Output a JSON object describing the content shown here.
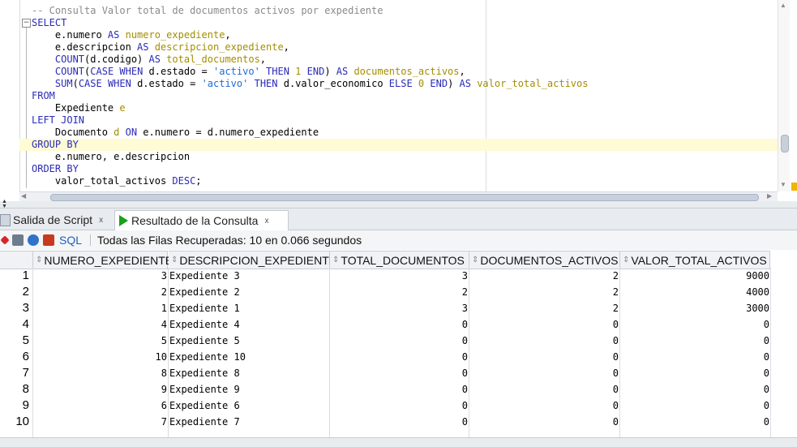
{
  "editor": {
    "lines": [
      [
        {
          "t": "-- Consulta Valor total de documentos activos por expediente",
          "c": "cm"
        }
      ],
      [
        {
          "t": "SELECT",
          "c": "kw"
        }
      ],
      [
        {
          "t": "    e.numero "
        },
        {
          "t": "AS",
          "c": "kw"
        },
        {
          "t": " numero_expediente",
          "c": "al"
        },
        {
          "t": ","
        }
      ],
      [
        {
          "t": "    e.descripcion "
        },
        {
          "t": "AS",
          "c": "kw"
        },
        {
          "t": " descripcion_expediente",
          "c": "al"
        },
        {
          "t": ","
        }
      ],
      [
        {
          "t": "    "
        },
        {
          "t": "COUNT",
          "c": "kw"
        },
        {
          "t": "(d.codigo) "
        },
        {
          "t": "AS",
          "c": "kw"
        },
        {
          "t": " total_documentos",
          "c": "al"
        },
        {
          "t": ","
        }
      ],
      [
        {
          "t": "    "
        },
        {
          "t": "COUNT",
          "c": "kw"
        },
        {
          "t": "("
        },
        {
          "t": "CASE WHEN",
          "c": "kw"
        },
        {
          "t": " d.estado = "
        },
        {
          "t": "'activo'",
          "c": "str"
        },
        {
          "t": " "
        },
        {
          "t": "THEN",
          "c": "kw"
        },
        {
          "t": " 1 ",
          "c": "al"
        },
        {
          "t": "END",
          "c": "kw"
        },
        {
          "t": ") "
        },
        {
          "t": "AS",
          "c": "kw"
        },
        {
          "t": " documentos_activos",
          "c": "al"
        },
        {
          "t": ","
        }
      ],
      [
        {
          "t": "    "
        },
        {
          "t": "SUM",
          "c": "kw"
        },
        {
          "t": "("
        },
        {
          "t": "CASE WHEN",
          "c": "kw"
        },
        {
          "t": " d.estado = "
        },
        {
          "t": "'activo'",
          "c": "str"
        },
        {
          "t": " "
        },
        {
          "t": "THEN",
          "c": "kw"
        },
        {
          "t": " d.valor_economico "
        },
        {
          "t": "ELSE",
          "c": "kw"
        },
        {
          "t": " 0 ",
          "c": "al"
        },
        {
          "t": "END",
          "c": "kw"
        },
        {
          "t": ") "
        },
        {
          "t": "AS",
          "c": "kw"
        },
        {
          "t": " valor_total_activos",
          "c": "al"
        }
      ],
      [
        {
          "t": "FROM",
          "c": "kw"
        }
      ],
      [
        {
          "t": "    Expediente "
        },
        {
          "t": "e",
          "c": "al"
        }
      ],
      [
        {
          "t": "LEFT JOIN",
          "c": "kw"
        }
      ],
      [
        {
          "t": "    Documento "
        },
        {
          "t": "d",
          "c": "al"
        },
        {
          "t": " "
        },
        {
          "t": "ON",
          "c": "kw"
        },
        {
          "t": " e.numero = d.numero_expediente"
        }
      ],
      [
        {
          "t": "GROUP BY",
          "c": "kw"
        }
      ],
      [
        {
          "t": "    e.numero, e.descripcion"
        }
      ],
      [
        {
          "t": "ORDER BY",
          "c": "kw"
        }
      ],
      [
        {
          "t": "    valor_total_activos "
        },
        {
          "t": "DESC",
          "c": "kw"
        },
        {
          "t": ";"
        }
      ]
    ],
    "current_line_index": 11
  },
  "tabs": [
    {
      "label": "Salida de Script",
      "close": "x",
      "active": false
    },
    {
      "label": "Resultado de la Consulta",
      "close": "x",
      "active": true
    }
  ],
  "toolbar": {
    "sql_label": "SQL",
    "status": "Todas las Filas Recuperadas: 10 en 0.066 segundos"
  },
  "grid": {
    "columns": [
      "NUMERO_EXPEDIENTE",
      "DESCRIPCION_EXPEDIENTE",
      "TOTAL_DOCUMENTOS",
      "DOCUMENTOS_ACTIVOS",
      "VALOR_TOTAL_ACTIVOS"
    ],
    "rows": [
      [
        "1",
        "3",
        "Expediente 3",
        "3",
        "2",
        "9000"
      ],
      [
        "2",
        "2",
        "Expediente 2",
        "2",
        "2",
        "4000"
      ],
      [
        "3",
        "1",
        "Expediente 1",
        "3",
        "2",
        "3000"
      ],
      [
        "4",
        "4",
        "Expediente 4",
        "0",
        "0",
        "0"
      ],
      [
        "5",
        "5",
        "Expediente 5",
        "0",
        "0",
        "0"
      ],
      [
        "6",
        "10",
        "Expediente 10",
        "0",
        "0",
        "0"
      ],
      [
        "7",
        "8",
        "Expediente 8",
        "0",
        "0",
        "0"
      ],
      [
        "8",
        "9",
        "Expediente 9",
        "0",
        "0",
        "0"
      ],
      [
        "9",
        "6",
        "Expediente 6",
        "0",
        "0",
        "0"
      ],
      [
        "10",
        "7",
        "Expediente 7",
        "0",
        "0",
        "0"
      ]
    ]
  },
  "icons": {
    "fold": "collapse-icon",
    "pin": "pin-icon",
    "print": "print-icon",
    "refresh": "refresh-icon",
    "delete": "delete-icon",
    "run": "run-icon",
    "sort": "sort-icon"
  }
}
